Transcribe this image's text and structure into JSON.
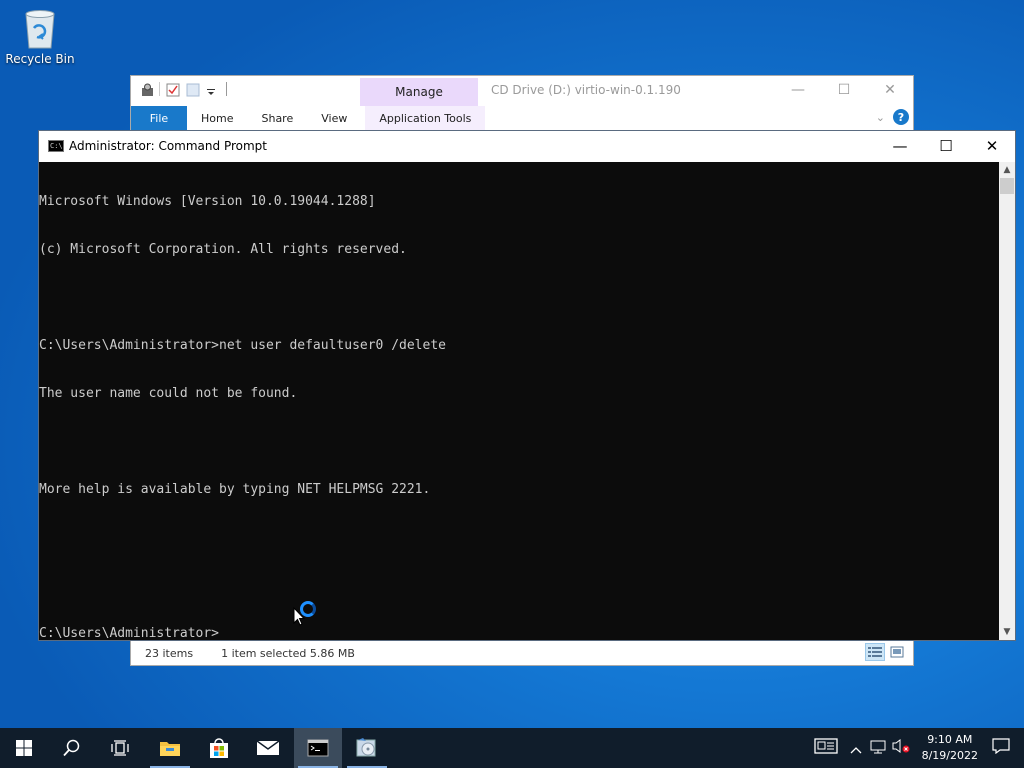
{
  "desktop": {
    "recycle_bin_label": "Recycle Bin"
  },
  "explorer": {
    "manage_tab": "Manage",
    "title": "CD Drive (D:) virtio-win-0.1.190",
    "ribbon_tabs": [
      "File",
      "Home",
      "Share",
      "View",
      "Application Tools"
    ],
    "status_items": "23 items",
    "status_selected": "1 item selected  5.86 MB",
    "help_label": "?"
  },
  "cmd": {
    "title": "Administrator: Command Prompt",
    "lines": [
      "Microsoft Windows [Version 10.0.19044.1288]",
      "(c) Microsoft Corporation. All rights reserved.",
      "",
      "C:\\Users\\Administrator>net user defaultuser0 /delete",
      "The user name could not be found.",
      "",
      "More help is available by typing NET HELPMSG 2221.",
      "",
      "",
      "C:\\Users\\Administrator>"
    ]
  },
  "taskbar": {
    "time": "9:10 AM",
    "date": "8/19/2022"
  },
  "colors": {
    "console_bg": "#0c0c0c",
    "console_fg": "#cccccc",
    "file_tab": "#1979ca",
    "manage_tab": "#ead9fb",
    "taskbar": "#101d2b"
  }
}
